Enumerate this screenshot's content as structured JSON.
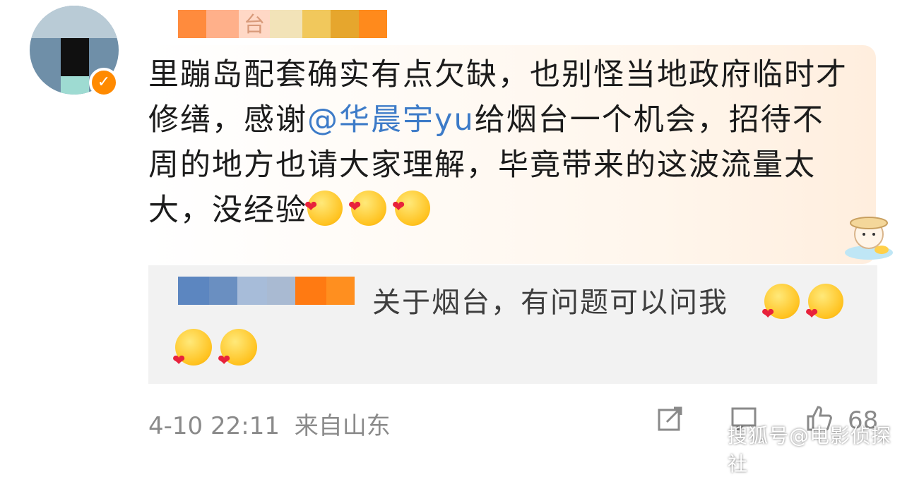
{
  "post": {
    "author_name_redacted": "台",
    "comment_prefix": "里蹦岛配套确实有点欠缺，也别怪当地政府临时才修缮，感谢",
    "mention": "@华晨宇yu",
    "comment_suffix": "给烟台一个机会，招待不周的地方也请大家理解，毕竟带来的这波流量太大，没经验",
    "timestamp": "4-10 22:11",
    "source": "来自山东",
    "like_count": "68"
  },
  "reply": {
    "text": "关于烟台，有问题可以问我"
  },
  "watermark": "搜狐号@电影侦探社",
  "icons": {
    "verified": "verified-badge-icon",
    "repost": "repost-icon",
    "comment": "comment-icon",
    "like": "like-icon"
  },
  "colors": {
    "mention": "#3d7bc8",
    "badge": "#ff8a00",
    "reply_bg": "#f2f2f2"
  }
}
